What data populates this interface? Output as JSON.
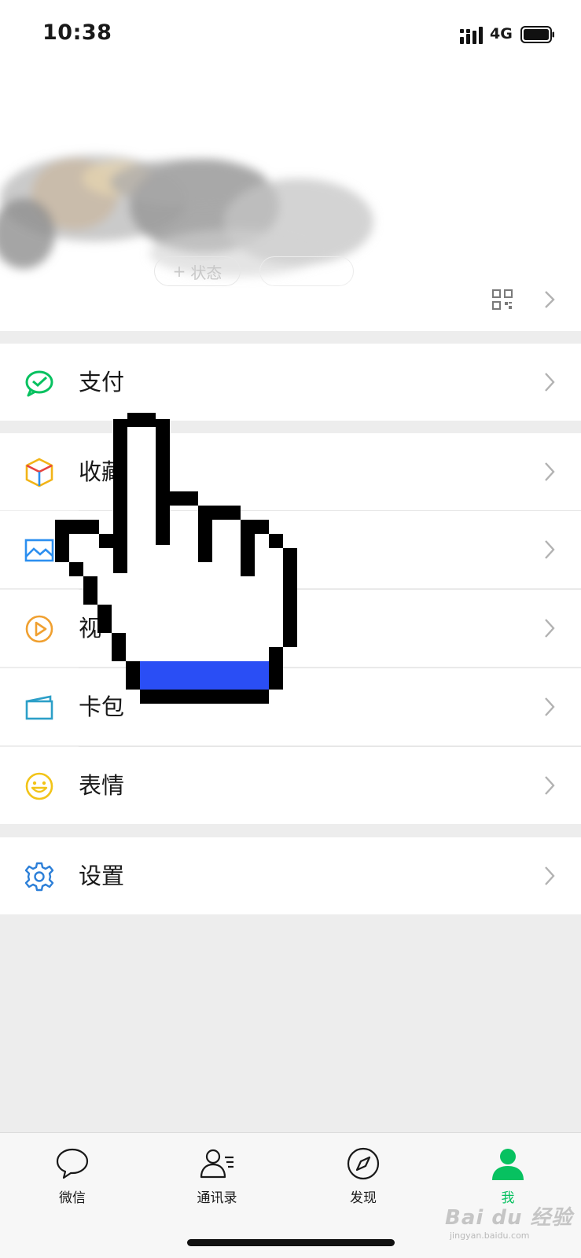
{
  "status_bar": {
    "time": "10:38",
    "network": "4G"
  },
  "profile": {
    "status_button": "状态"
  },
  "menu": {
    "pay": "支付",
    "favorites": "收藏",
    "moments": "",
    "channels": "视",
    "cards": "卡包",
    "stickers": "表情",
    "settings": "设置"
  },
  "tabs": [
    {
      "label": "微信"
    },
    {
      "label": "通讯录"
    },
    {
      "label": "发现"
    },
    {
      "label": "我"
    }
  ],
  "watermark": {
    "brand": "Bai du 经验",
    "url": "jingyan.baidu.com"
  },
  "colors": {
    "accent": "#07c160",
    "background": "#ededed",
    "cursor_fill": "#2a4ef5"
  },
  "icons": [
    "pay-icon",
    "favorites-icon",
    "moments-icon",
    "channels-icon",
    "cards-icon",
    "stickers-icon",
    "settings-icon",
    "qr-code-icon",
    "chevron-right-icon",
    "hand-cursor-icon"
  ]
}
